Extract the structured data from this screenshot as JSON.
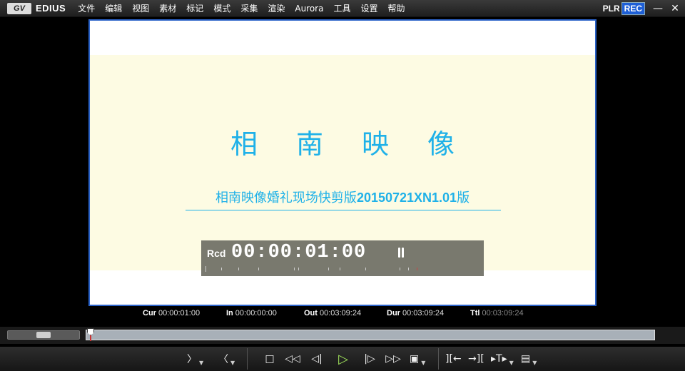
{
  "app": {
    "logo_text": "GV",
    "name": "EDIUS",
    "menu": [
      "文件",
      "编辑",
      "视图",
      "素材",
      "标记",
      "模式",
      "采集",
      "渲染",
      "Aurora",
      "工具",
      "设置",
      "帮助"
    ],
    "mode_plr": "PLR",
    "mode_rec": "REC"
  },
  "preview": {
    "title": "相南映像",
    "subtitle_prefix": "相南映像婚礼现场快剪版",
    "subtitle_code": "20150721XN1.01",
    "subtitle_suffix": "版",
    "overlay_label": "Rcd",
    "overlay_timecode": "00:00:01:00"
  },
  "info": {
    "cur_label": "Cur",
    "cur_value": "00:00:01:00",
    "in_label": "In",
    "in_value": "00:00:00:00",
    "out_label": "Out",
    "out_value": "00:03:09:24",
    "dur_label": "Dur",
    "dur_value": "00:03:09:24",
    "ttl_label": "Ttl",
    "ttl_value": "00:03:09:24"
  },
  "colors": {
    "title_text": "#1fb1e8",
    "rec_badge": "#1e5fd6",
    "play_button": "#9fe05a",
    "frame_border": "#2a62c8"
  }
}
